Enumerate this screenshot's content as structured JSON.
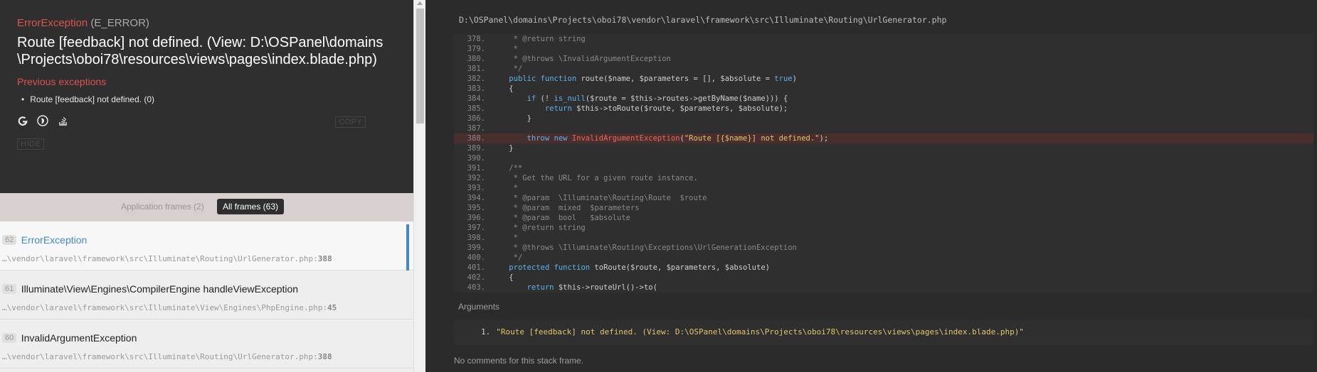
{
  "header": {
    "exception_class": "ErrorException",
    "exception_code": "(E_ERROR)",
    "message": "Route [feedback] not defined. (View: D:\\OSPanel\\domains\\Projects\\oboi78\\resources\\views\\pages\\index.blade.php)",
    "previous_title": "Previous exceptions",
    "previous_items": [
      "Route [feedback] not defined. (0)"
    ],
    "icons": [
      "google-icon",
      "duckduckgo-icon",
      "stackoverflow-icon"
    ],
    "copy_label": "COPY",
    "hide_label": "HIDE"
  },
  "frames_tabs": {
    "app_label": "Application frames (2)",
    "all_label": "All frames (63)"
  },
  "frames": [
    {
      "num": "62",
      "cls": "ErrorException",
      "file": "…\\vendor\\laravel\\framework\\src\\Illuminate\\Routing\\UrlGenerator.php",
      "line": "388"
    },
    {
      "num": "61",
      "cls": "Illuminate\\View\\Engines\\CompilerEngine handleViewException",
      "file": "…\\vendor\\laravel\\framework\\src\\Illuminate\\View\\Engines\\PhpEngine.php",
      "line": "45"
    },
    {
      "num": "60",
      "cls": "InvalidArgumentException",
      "file": "…\\vendor\\laravel\\framework\\src\\Illuminate\\Routing\\UrlGenerator.php",
      "line": "388"
    }
  ],
  "code": {
    "file_path": "D:\\OSPanel\\domains\\Projects\\oboi78\\vendor\\laravel\\framework\\src\\Illuminate\\Routing\\UrlGenerator.php",
    "highlight_line": "388.",
    "lines": [
      {
        "n": "378.",
        "t": "     * @return string"
      },
      {
        "n": "379.",
        "t": "     *"
      },
      {
        "n": "380.",
        "t": "     * @throws \\InvalidArgumentException"
      },
      {
        "n": "381.",
        "t": "     */"
      },
      {
        "n": "382.",
        "t": "    public function route($name, $parameters = [], $absolute = true)"
      },
      {
        "n": "383.",
        "t": "    {"
      },
      {
        "n": "384.",
        "t": "        if (! is_null($route = $this->routes->getByName($name))) {"
      },
      {
        "n": "385.",
        "t": "            return $this->toRoute($route, $parameters, $absolute);"
      },
      {
        "n": "386.",
        "t": "        }"
      },
      {
        "n": "387.",
        "t": ""
      },
      {
        "n": "388.",
        "t": "        throw new InvalidArgumentException(\"Route [{$name}] not defined.\");"
      },
      {
        "n": "389.",
        "t": "    }"
      },
      {
        "n": "390.",
        "t": ""
      },
      {
        "n": "391.",
        "t": "    /**"
      },
      {
        "n": "392.",
        "t": "     * Get the URL for a given route instance."
      },
      {
        "n": "393.",
        "t": "     *"
      },
      {
        "n": "394.",
        "t": "     * @param  \\Illuminate\\Routing\\Route  $route"
      },
      {
        "n": "395.",
        "t": "     * @param  mixed  $parameters"
      },
      {
        "n": "396.",
        "t": "     * @param  bool   $absolute"
      },
      {
        "n": "397.",
        "t": "     * @return string"
      },
      {
        "n": "398.",
        "t": "     *"
      },
      {
        "n": "399.",
        "t": "     * @throws \\Illuminate\\Routing\\Exceptions\\UrlGenerationException"
      },
      {
        "n": "400.",
        "t": "     */"
      },
      {
        "n": "401.",
        "t": "    protected function toRoute($route, $parameters, $absolute)"
      },
      {
        "n": "402.",
        "t": "    {"
      },
      {
        "n": "403.",
        "t": "        return $this->routeUrl()->to("
      }
    ]
  },
  "arguments": {
    "title": "Arguments",
    "items": [
      {
        "num": "1.",
        "value": "\"Route [feedback] not defined. (View: D:\\OSPanel\\domains\\Projects\\oboi78\\resources\\views\\pages\\index.blade.php)\""
      }
    ]
  },
  "comments": {
    "text": "No comments for this stack frame."
  },
  "colors": {
    "accent": "#4288ce",
    "error": "#d9534f",
    "string": "#e6c46a",
    "keyword": "#5fb3e6"
  }
}
